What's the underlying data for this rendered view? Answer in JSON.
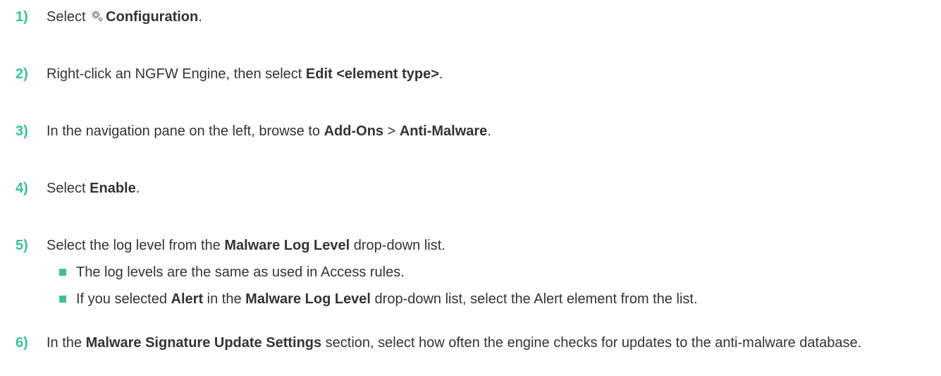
{
  "steps": [
    {
      "num": "1)",
      "parts": [
        {
          "t": "Select "
        },
        {
          "icon": "gear"
        },
        {
          "b": "Configuration"
        },
        {
          "t": "."
        }
      ]
    },
    {
      "num": "2)",
      "parts": [
        {
          "t": "Right-click an NGFW Engine, then select "
        },
        {
          "b": "Edit <element type>"
        },
        {
          "t": "."
        }
      ]
    },
    {
      "num": "3)",
      "parts": [
        {
          "t": "In the navigation pane on the left, browse to "
        },
        {
          "b": "Add-Ons"
        },
        {
          "t": " > "
        },
        {
          "b": "Anti-Malware"
        },
        {
          "t": "."
        }
      ]
    },
    {
      "num": "4)",
      "parts": [
        {
          "t": "Select "
        },
        {
          "b": "Enable"
        },
        {
          "t": "."
        }
      ]
    },
    {
      "num": "5)",
      "parts": [
        {
          "t": "Select the log level from the "
        },
        {
          "b": "Malware Log Level"
        },
        {
          "t": " drop-down list."
        }
      ]
    },
    {
      "num": "6)",
      "parts": [
        {
          "t": "In the "
        },
        {
          "b": "Malware Signature Update Settings"
        },
        {
          "t": " section, select how often the engine checks for updates to the anti-malware database."
        }
      ]
    }
  ],
  "substeps": [
    {
      "parts": [
        {
          "t": "The log levels are the same as used in Access rules."
        }
      ]
    },
    {
      "parts": [
        {
          "t": "If you selected "
        },
        {
          "b": "Alert"
        },
        {
          "t": " in the "
        },
        {
          "b": "Malware Log Level"
        },
        {
          "t": " drop-down list, select the Alert element from the list."
        }
      ]
    }
  ],
  "colors": {
    "accent": "#3dbf9c",
    "text": "#333333"
  },
  "icons": {
    "configuration": "gear-icon"
  }
}
